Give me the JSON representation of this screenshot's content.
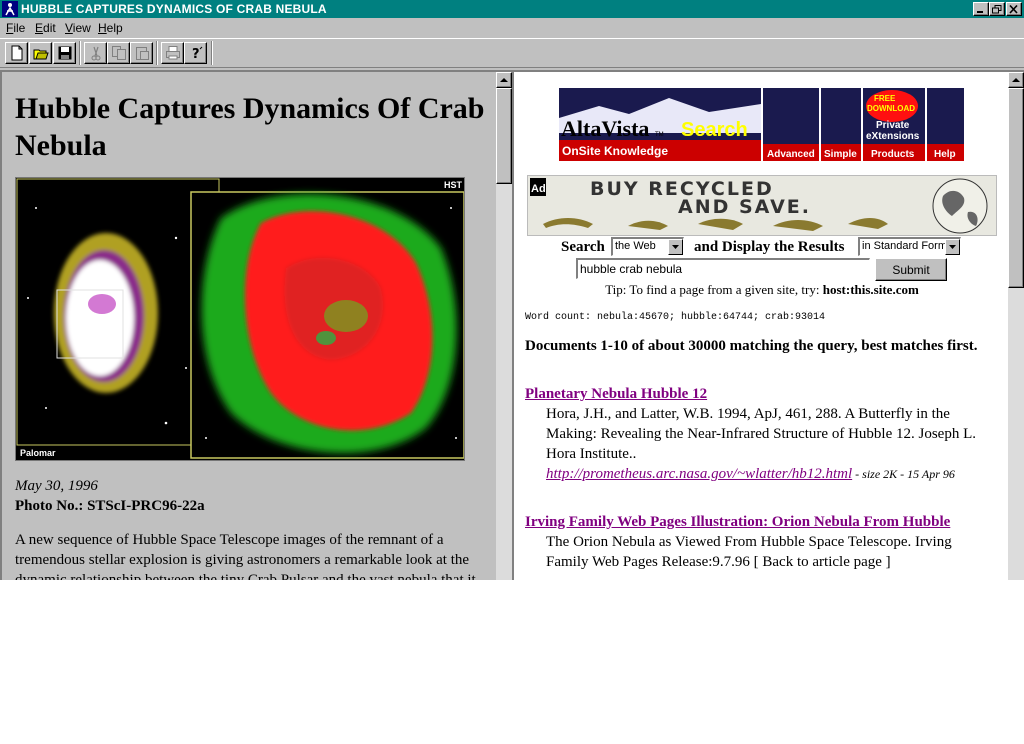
{
  "window": {
    "title": "HUBBLE CAPTURES DYNAMICS OF CRAB NEBULA"
  },
  "menu": {
    "items": [
      {
        "label": "File",
        "key": "F",
        "rest": "ile"
      },
      {
        "label": "Edit",
        "key": "E",
        "rest": "dit"
      },
      {
        "label": "View",
        "key": "V",
        "rest": "iew"
      },
      {
        "label": "Help",
        "key": "H",
        "rest": "elp"
      }
    ]
  },
  "toolbar": {
    "buttons": [
      "new-document-icon",
      "open-folder-icon",
      "save-disk-icon",
      "cut-scissors-icon",
      "copy-icon",
      "paste-icon",
      "print-icon",
      "help-question-icon"
    ]
  },
  "article": {
    "title": "Hubble Captures Dynamics Of Crab Nebula",
    "image_labels": {
      "left": "Palomar",
      "right": "HST"
    },
    "date": "May 30, 1996",
    "photo_no": "Photo No.: STScI-PRC96-22a",
    "body": "A new sequence of Hubble Space Telescope images of the remnant of a tremendous stellar explosion is giving astronomers a remarkable look at the dynamic relationship between the tiny Crab Pulsar and the vast nebula that it"
  },
  "search": {
    "banner": {
      "logo": "AltaVista",
      "logo_tm": "TM",
      "search_word": "Search",
      "tagline": "OnSite Knowledge",
      "tabs": [
        "Advanced",
        "Simple",
        "Products",
        "Help"
      ],
      "badge_lines": [
        "FREE",
        "DOWNLOAD"
      ],
      "ext_lines": [
        "Private",
        "eXtensions"
      ]
    },
    "ad": {
      "badge": "Ad",
      "line1": "BUY RECYCLED",
      "line2": "AND SAVE."
    },
    "form": {
      "search_label": "Search",
      "scope_value": "the Web",
      "display_label": "and Display the Results",
      "format_value": "in Standard Form",
      "query": "hubble crab nebula",
      "submit_label": "Submit",
      "tip_prefix": "Tip: To find a page from a given site, try: ",
      "tip_example": "host:this.site.com"
    },
    "word_count": "Word count: nebula:45670; hubble:64744; crab:93014",
    "summary": "Documents 1-10 of about 30000 matching the query, best matches first.",
    "results": [
      {
        "title": "Planetary Nebula Hubble 12",
        "description": "Hora, J.H., and Latter, W.B. 1994, ApJ, 461, 288. A Butterfly in the Making: Revealing the Near-Infrared Structure of Hubble 12. Joseph L. Hora Institute..",
        "url": "http://prometheus.arc.nasa.gov/~wlatter/hb12.html",
        "meta": " - size 2K - 15 Apr 96"
      },
      {
        "title": "Irving Family Web Pages Illustration: Orion Nebula From Hubble",
        "description": "The Orion Nebula as Viewed From Hubble Space Telescope. Irving Family Web Pages Release:9.7.96 [ Back to article page ]",
        "url": "",
        "meta": ""
      }
    ]
  },
  "colors": {
    "titlebar": "#008080",
    "chrome": "#c0c0c0",
    "visited_link": "#800080",
    "altavista_red": "#cc0000",
    "altavista_navy": "#1a1a4e"
  }
}
